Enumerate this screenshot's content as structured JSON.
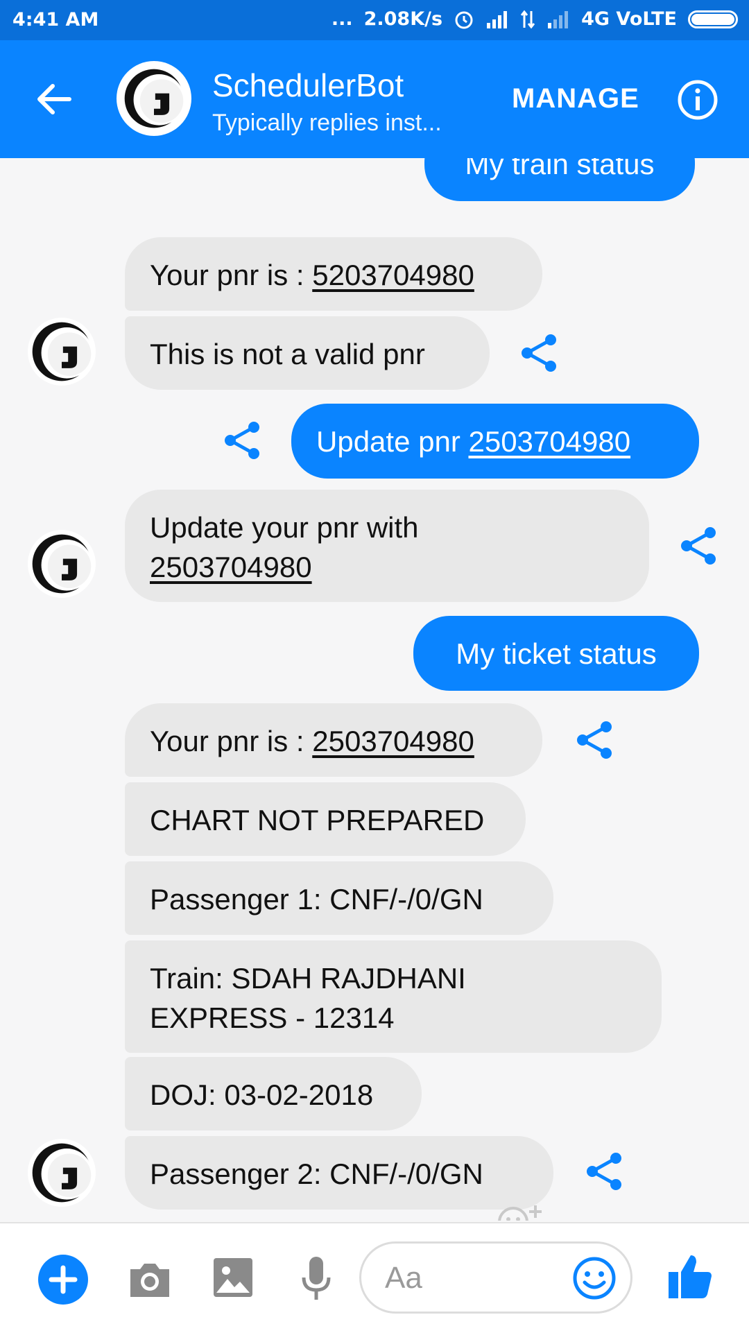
{
  "status_bar": {
    "time": "4:41 AM",
    "dots": "...",
    "speed": "2.08K/s",
    "network": "4G VoLTE"
  },
  "header": {
    "title": "SchedulerBot",
    "subtitle": "Typically replies inst...",
    "manage_label": "MANAGE"
  },
  "messages": {
    "m1": "My train status",
    "m2_prefix": "Your pnr is : ",
    "m2_pnr": "5203704980",
    "m3": "This is not a valid pnr",
    "m4_prefix": "Update pnr ",
    "m4_pnr": "2503704980",
    "m5_line1": "Update your pnr with",
    "m5_pnr": "2503704980",
    "m6": "My ticket status",
    "m7_prefix": "Your pnr is : ",
    "m7_pnr": "2503704980",
    "m8": "CHART NOT PREPARED",
    "m9": "Passenger 1: CNF/-/0/GN",
    "m10_line1": "Train: SDAH RAJDHANI",
    "m10_line2": "EXPRESS - 12314",
    "m11": "DOJ: 03-02-2018",
    "m12": "Passenger 2: CNF/-/0/GN"
  },
  "composer": {
    "placeholder": "Aa"
  },
  "colors": {
    "accent": "#0a84ff",
    "status_bar": "#0a6fd9",
    "incoming_bubble": "#e8e8e8",
    "background": "#f6f6f7"
  },
  "icons": {
    "back": "arrow-left-icon",
    "info": "info-icon",
    "share": "share-icon",
    "add": "plus-icon",
    "camera": "camera-icon",
    "gallery": "image-icon",
    "mic": "microphone-icon",
    "emoji": "smiley-icon",
    "like": "thumbs-up-icon"
  }
}
